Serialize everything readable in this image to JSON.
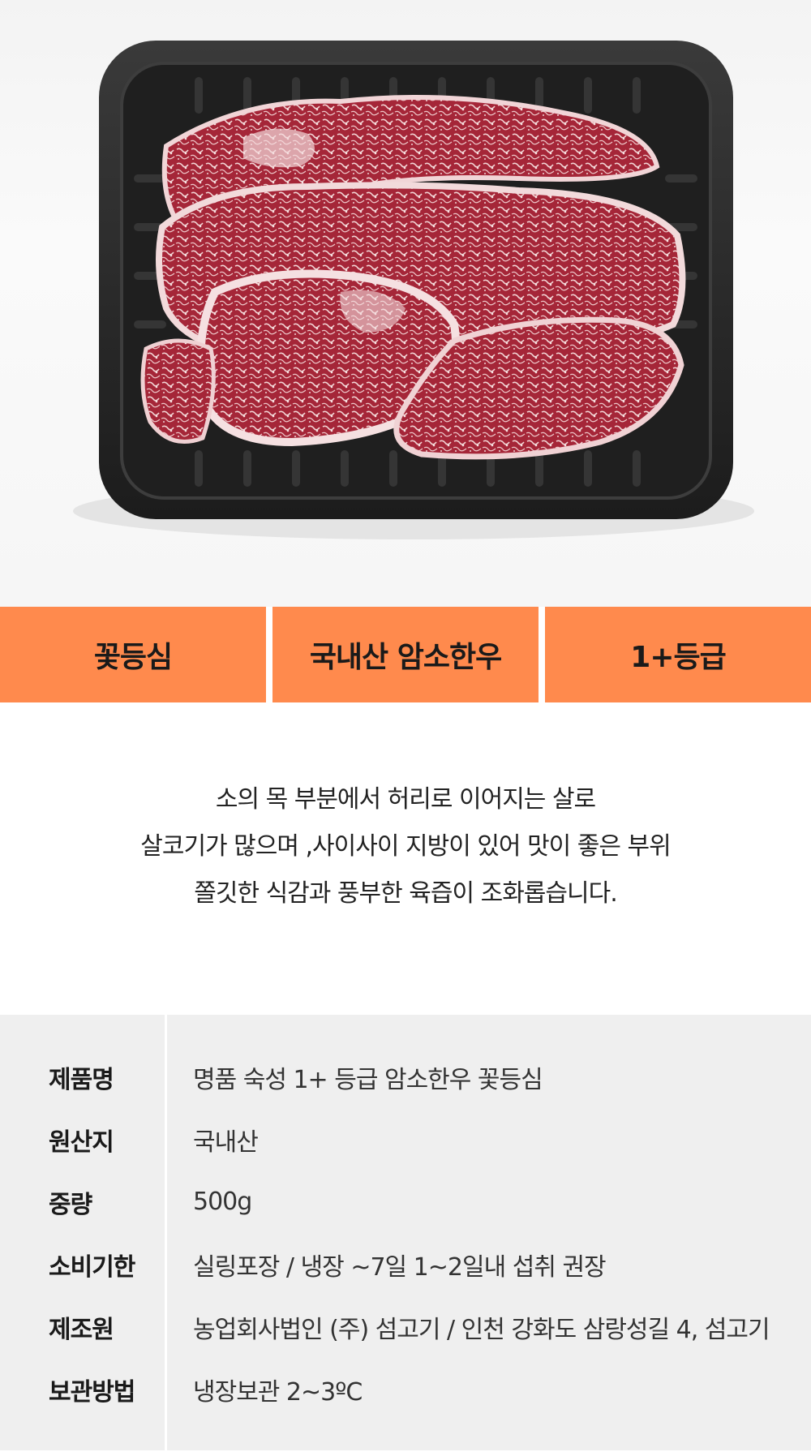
{
  "hero": {
    "image_label": "beef-tray-photo"
  },
  "tags": [
    {
      "label": "꽃등심"
    },
    {
      "label": "국내산 암소한우"
    },
    {
      "label": "1+등급"
    }
  ],
  "description": {
    "lines": [
      "소의 목 부분에서 허리로 이어지는  살로",
      "살코기가 많으며 ,사이사이 지방이 있어 맛이 좋은 부위",
      "쫄깃한 식감과 풍부한 육즙이 조화롭습니다."
    ]
  },
  "info": {
    "rows": [
      {
        "key": "제품명",
        "value": "명품 숙성 1+ 등급 암소한우 꽃등심"
      },
      {
        "key": "원산지",
        "value": " 국내산"
      },
      {
        "key": "중량",
        "value": "500g"
      },
      {
        "key": "소비기한",
        "value": "실링포장  / 냉장 ~7일   1~2일내 섭취 권장"
      },
      {
        "key": "제조원",
        "value": "농업회사법인 (주) 섬고기 / 인천 강화도 삼랑성길 4, 섬고기"
      },
      {
        "key": "보관방법",
        "value": "냉장보관 2~3ºC"
      }
    ]
  },
  "colors": {
    "tag_background": "#ff8a4d",
    "info_background": "#efefef"
  }
}
